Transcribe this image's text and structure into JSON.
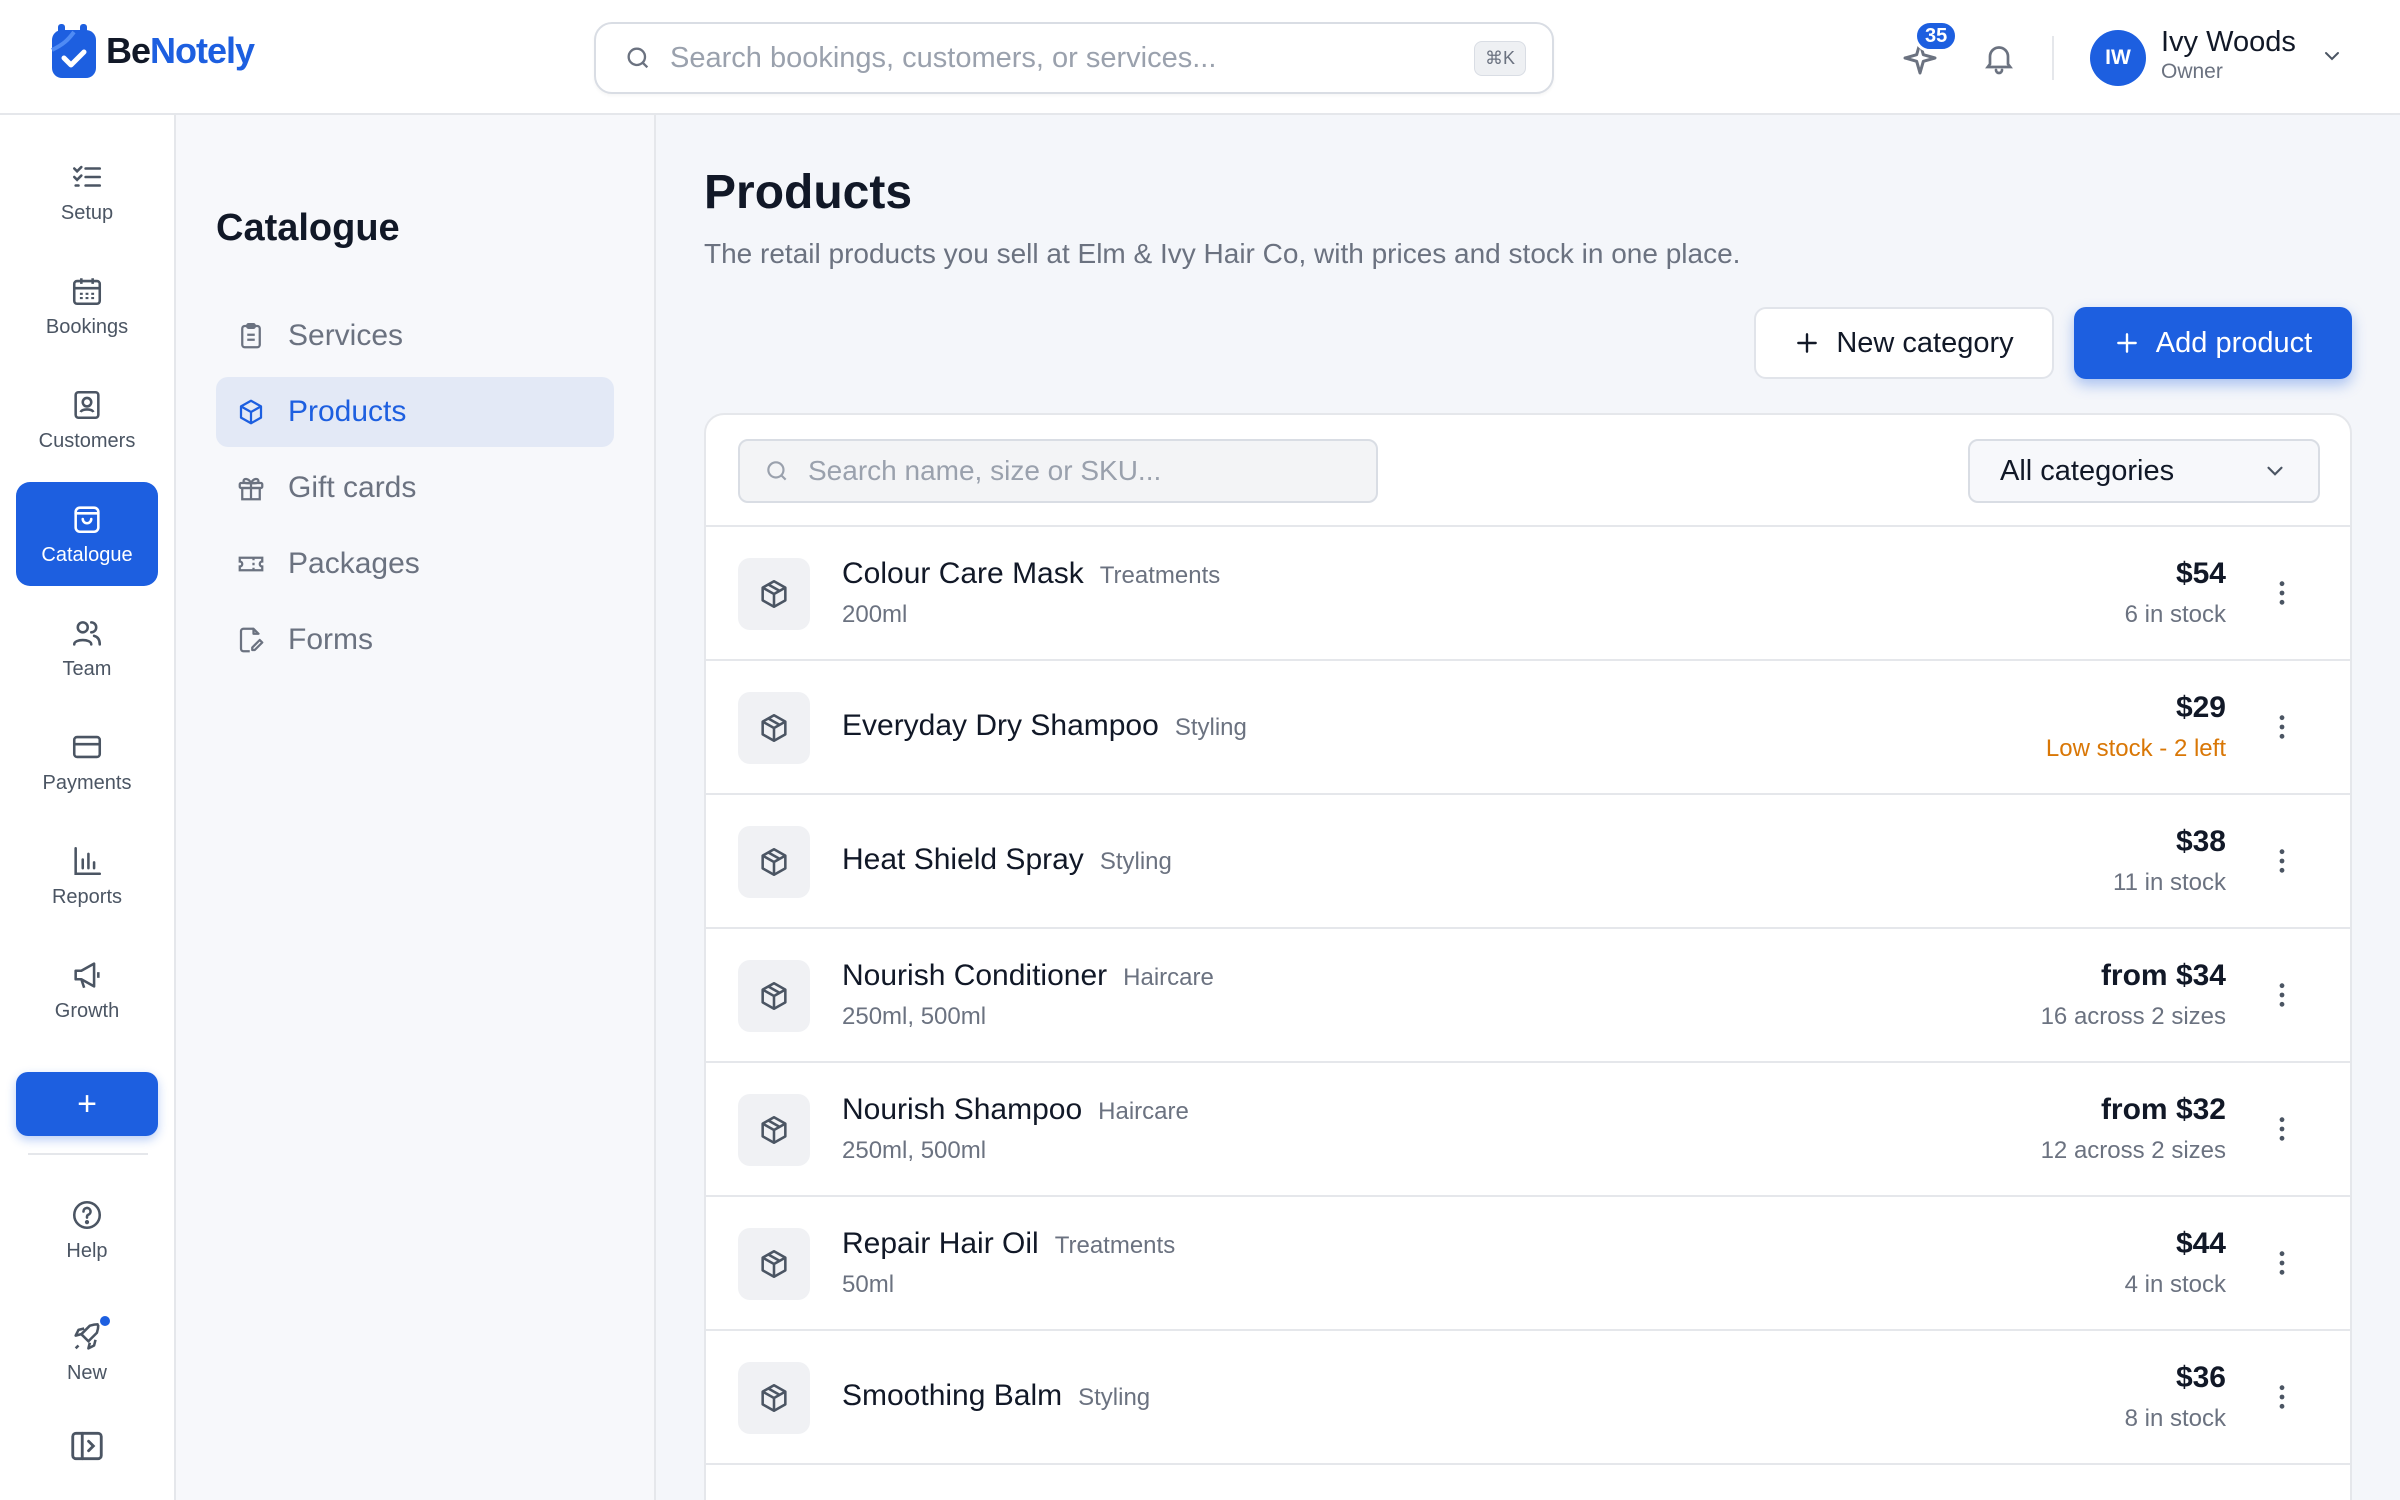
{
  "app": {
    "brand_prefix": "Be",
    "brand_suffix": "Notely",
    "search_placeholder": "Search bookings, customers, or services...",
    "search_shortcut": "⌘K",
    "notification_count": "35",
    "user": {
      "initials": "IW",
      "name": "Ivy Woods",
      "role": "Owner"
    }
  },
  "rail": {
    "items": [
      {
        "label": "Setup",
        "icon": "checklist-icon"
      },
      {
        "label": "Bookings",
        "icon": "calendar-icon"
      },
      {
        "label": "Customers",
        "icon": "contact-card-icon"
      },
      {
        "label": "Catalogue",
        "icon": "shopping-bag-icon",
        "active": true
      },
      {
        "label": "Team",
        "icon": "users-icon"
      },
      {
        "label": "Payments",
        "icon": "credit-card-icon"
      },
      {
        "label": "Reports",
        "icon": "bar-chart-icon"
      },
      {
        "label": "Growth",
        "icon": "megaphone-icon"
      }
    ],
    "add_label": "+",
    "help_label": "Help",
    "new_label": "New"
  },
  "subnav": {
    "title": "Catalogue",
    "items": [
      {
        "label": "Services",
        "icon": "clipboard-icon"
      },
      {
        "label": "Products",
        "icon": "box-icon",
        "active": true
      },
      {
        "label": "Gift cards",
        "icon": "gift-icon"
      },
      {
        "label": "Packages",
        "icon": "ticket-icon"
      },
      {
        "label": "Forms",
        "icon": "form-edit-icon"
      }
    ]
  },
  "page": {
    "title": "Products",
    "subtitle": "The retail products you sell at Elm & Ivy Hair Co, with prices and stock in one place.",
    "new_category_label": "New category",
    "add_product_label": "Add product",
    "list_search_placeholder": "Search name, size or SKU...",
    "category_filter": "All categories"
  },
  "products": [
    {
      "name": "Colour Care Mask",
      "category": "Treatments",
      "sizes": "200ml",
      "price": "$54",
      "stock": "6 in stock",
      "low": false
    },
    {
      "name": "Everyday Dry Shampoo",
      "category": "Styling",
      "sizes": "",
      "price": "$29",
      "stock": "Low stock - 2 left",
      "low": true
    },
    {
      "name": "Heat Shield Spray",
      "category": "Styling",
      "sizes": "",
      "price": "$38",
      "stock": "11 in stock",
      "low": false
    },
    {
      "name": "Nourish Conditioner",
      "category": "Haircare",
      "sizes": "250ml, 500ml",
      "price": "from $34",
      "stock": "16 across 2 sizes",
      "low": false
    },
    {
      "name": "Nourish Shampoo",
      "category": "Haircare",
      "sizes": "250ml, 500ml",
      "price": "from $32",
      "stock": "12 across 2 sizes",
      "low": false
    },
    {
      "name": "Repair Hair Oil",
      "category": "Treatments",
      "sizes": "50ml",
      "price": "$44",
      "stock": "4 in stock",
      "low": false
    },
    {
      "name": "Smoothing Balm",
      "category": "Styling",
      "sizes": "",
      "price": "$36",
      "stock": "8 in stock",
      "low": false
    }
  ],
  "colors": {
    "accent": "#1d5fe0",
    "low_stock": "#d97706",
    "muted": "#6b7280"
  }
}
